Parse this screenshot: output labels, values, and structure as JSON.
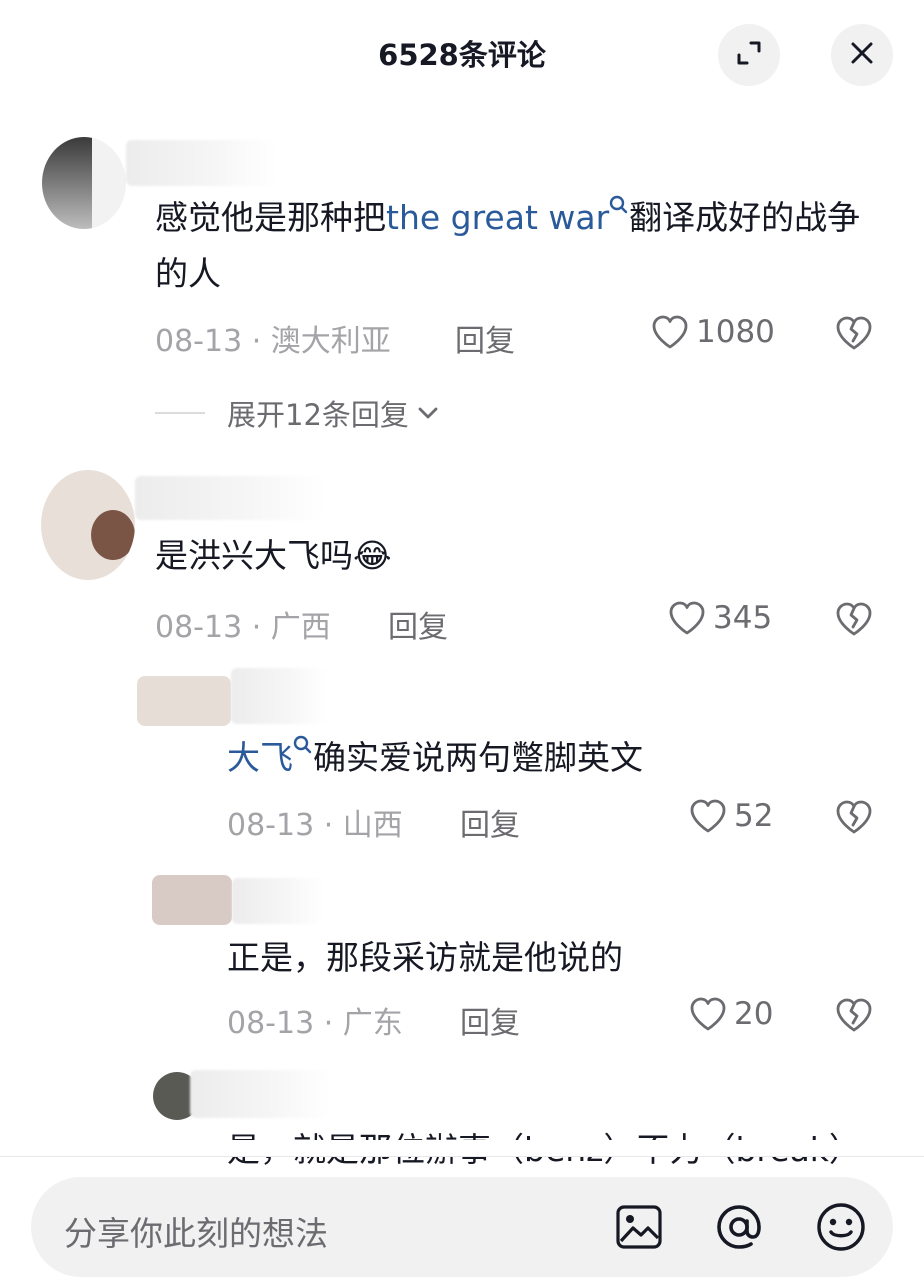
{
  "header": {
    "title": "6528条评论"
  },
  "comments": [
    {
      "text_before": "感觉他是那种把",
      "link": "the great war",
      "text_after": "翻译成好的战争的人",
      "date": "08-13",
      "location": "澳大利亚",
      "reply_label": "回复",
      "likes": "1080",
      "expand_label": "展开12条回复"
    },
    {
      "text": "是洪兴大飞吗",
      "emoji": "😂",
      "date": "08-13",
      "location": "广西",
      "reply_label": "回复",
      "likes": "345"
    }
  ],
  "replies": [
    {
      "link": "大飞",
      "text": "确实爱说两句蹩脚英文",
      "date": "08-13",
      "location": "山西",
      "reply_label": "回复",
      "likes": "52"
    },
    {
      "text": "正是，那段采访就是他说的",
      "date": "08-13",
      "location": "广东",
      "reply_label": "回复",
      "likes": "20"
    },
    {
      "text_partial": "是，就是那位辦事（benz）不力（break）"
    }
  ],
  "input": {
    "placeholder": "分享你此刻的想法"
  },
  "icons": {
    "expand": "expand-icon",
    "close": "close-icon",
    "search_link": "search-link-icon",
    "like": "heart-icon",
    "dislike": "broken-heart-icon",
    "image": "image-icon",
    "mention": "at-icon",
    "emoji": "emoji-icon",
    "chevron": "chevron-down-icon"
  },
  "colors": {
    "link": "#2b5a9b",
    "text": "#161823",
    "meta": "#a4a4a8"
  }
}
